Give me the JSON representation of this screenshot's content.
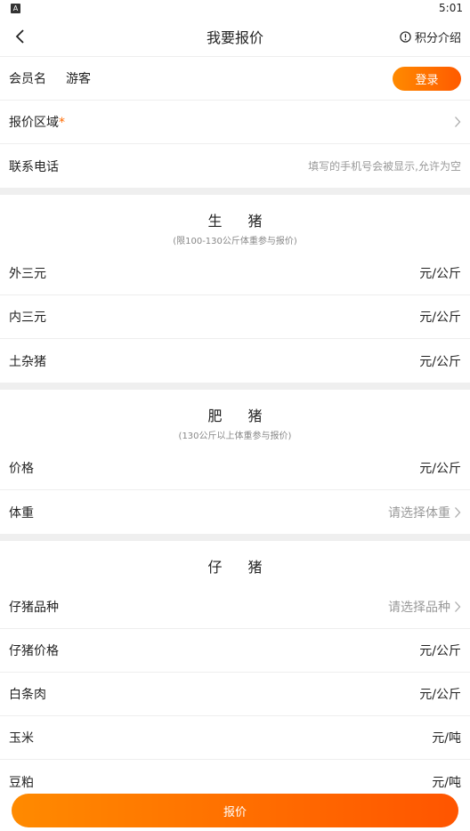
{
  "status_bar": {
    "app_icon_letter": "A",
    "time": "5:01"
  },
  "header": {
    "title": "我要报价",
    "points_label": "积分介绍"
  },
  "member": {
    "label": "会员名",
    "name": "游客",
    "login_label": "登录"
  },
  "region": {
    "label": "报价区域",
    "required_mark": "*"
  },
  "phone": {
    "label": "联系电话",
    "placeholder": "填写的手机号会被显示,允许为空"
  },
  "live_pig": {
    "title": "生 猪",
    "subtitle": "(限100-130公斤体重参与报价)",
    "rows": [
      {
        "label": "外三元",
        "unit": "元/公斤"
      },
      {
        "label": "内三元",
        "unit": "元/公斤"
      },
      {
        "label": "土杂猪",
        "unit": "元/公斤"
      }
    ]
  },
  "fat_pig": {
    "title": "肥 猪",
    "subtitle": "(130公斤以上体重参与报价)",
    "price": {
      "label": "价格",
      "unit": "元/公斤"
    },
    "weight": {
      "label": "体重",
      "placeholder": "请选择体重"
    }
  },
  "piglet": {
    "title": "仔 猪",
    "breed": {
      "label": "仔猪品种",
      "placeholder": "请选择品种"
    },
    "rows": [
      {
        "label": "仔猪价格",
        "unit": "元/公斤"
      },
      {
        "label": "白条肉",
        "unit": "元/公斤"
      },
      {
        "label": "玉米",
        "unit": "元/吨"
      },
      {
        "label": "豆粕",
        "unit": "元/吨"
      }
    ]
  },
  "submit_label": "报价",
  "colors": {
    "accent": "#ff6a00",
    "divider": "#efefef"
  }
}
